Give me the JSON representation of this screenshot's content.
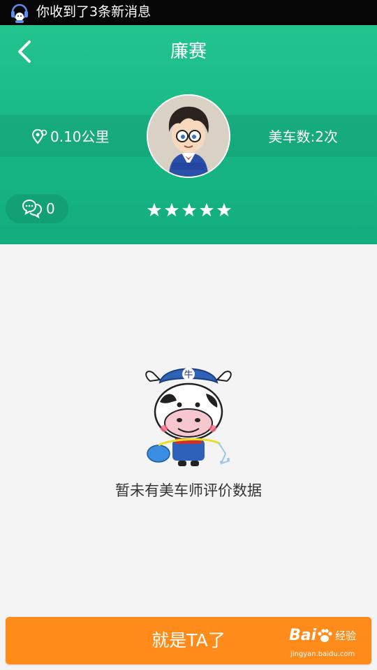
{
  "status_bar": {
    "notification": "你收到了3条新消息"
  },
  "header": {
    "title": "廉赛",
    "distance": "0.10公里",
    "service_count": "美车数:2次",
    "comment_count": "0",
    "rating_stars": 5
  },
  "empty_state": {
    "message": "暂未有美车师评价数据"
  },
  "cta": {
    "label": "就是TA了"
  },
  "watermark": {
    "brand": "Bai",
    "brand_cn": "经验",
    "url": "jingyan.baidu.com"
  },
  "colors": {
    "header_green": "#17b685",
    "cta_orange": "#ff8c1a",
    "status_bar": "#060606"
  }
}
